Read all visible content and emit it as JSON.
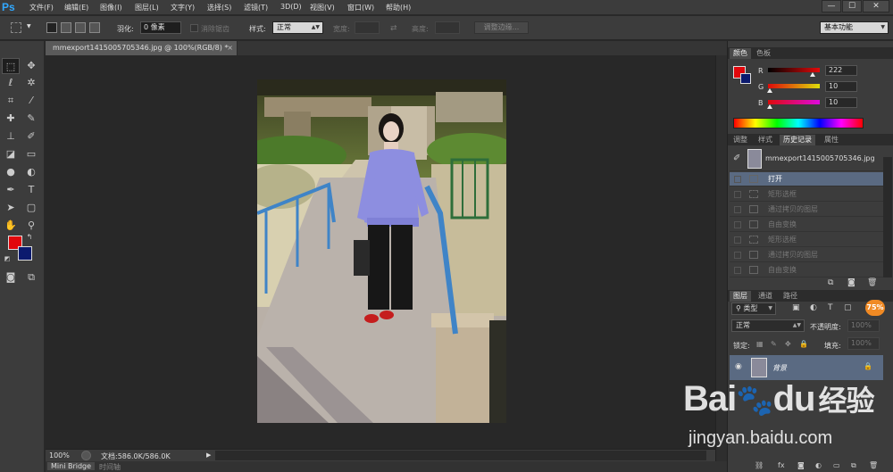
{
  "app": {
    "logo": "Ps",
    "menus": [
      "文件(F)",
      "编辑(E)",
      "图像(I)",
      "图层(L)",
      "文字(Y)",
      "选择(S)",
      "滤镜(T)",
      "3D(D)",
      "视图(V)",
      "窗口(W)",
      "帮助(H)"
    ],
    "window_buttons": [
      "—",
      "☐",
      "✕"
    ]
  },
  "options": {
    "feather_label": "羽化:",
    "feather_value": "0 像素",
    "antialias_label": "消除锯齿",
    "style_label": "样式:",
    "style_value": "正常",
    "width_label": "宽度:",
    "height_label": "高度:",
    "refine_edge_button": "调整边缘...",
    "workspace_value": "基本功能"
  },
  "document": {
    "tab_title": "mmexport1415005705346.jpg @ 100%(RGB/8) *",
    "tab_close": "×"
  },
  "status": {
    "zoom": "100%",
    "doc_size": "文档:586.0K/586.0K",
    "play": "▶"
  },
  "bottom_tabs": [
    "Mini Bridge",
    "时间轴"
  ],
  "color_panel": {
    "tabs": [
      "颜色",
      "色板"
    ],
    "r_label": "R",
    "g_label": "G",
    "b_label": "B",
    "r_value": "222",
    "g_value": "10",
    "b_value": "10",
    "r_fraction": 0.87,
    "g_fraction": 0.04,
    "b_fraction": 0.04,
    "foreground_color": "#e2070c",
    "background_color": "#0c1a6e"
  },
  "history_panel": {
    "tabs": [
      "调整",
      "样式",
      "历史记录",
      "属性"
    ],
    "snapshot_name": "mmexport1415005705346.jpg",
    "items": [
      "打开",
      "矩形选框",
      "通过拷贝的图层",
      "自由变换",
      "矩形选框",
      "通过拷贝的图层",
      "自由变换"
    ]
  },
  "layers_panel": {
    "tabs": [
      "图层",
      "通道",
      "路径"
    ],
    "kind_label": "类型",
    "blend_mode": "正常",
    "opacity_label": "不透明度:",
    "opacity_value": "100%",
    "lock_label": "锁定:",
    "fill_label": "填充:",
    "fill_value": "100%",
    "layer_name": "背景",
    "badge": "75%"
  },
  "watermark": {
    "brand": "Bai",
    "brand2": "du",
    "cn": "经验",
    "url": "jingyan.baidu.com"
  }
}
